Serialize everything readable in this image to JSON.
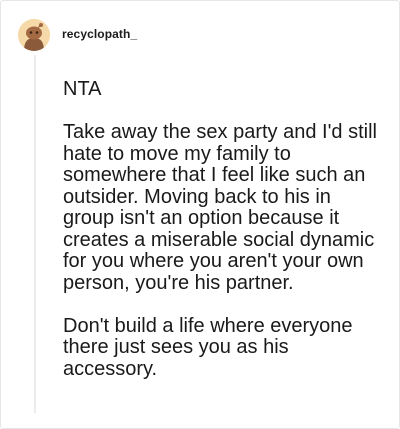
{
  "comment": {
    "username": "recyclopath_",
    "paragraphs": [
      "NTA",
      "Take away the sex party and I'd still hate to move my family to somewhere that I feel like such an outsider. Moving back to his in group isn't an option because it creates a miserable social dynamic for you where you aren't your own person, you're his partner.",
      "Don't build a life where everyone there just sees you as his accessory."
    ]
  },
  "colors": {
    "avatar_bg": "#f6d9a8",
    "avatar_figure": "#8a5a3b",
    "text": "#1a1a1b",
    "thread_line": "#ececec"
  },
  "icons": {
    "avatar": "snoo-avatar-icon"
  }
}
